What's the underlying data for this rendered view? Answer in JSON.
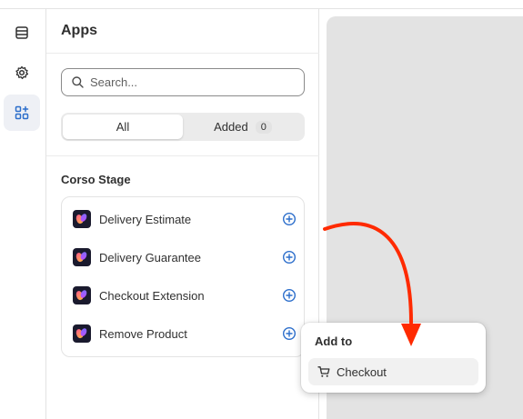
{
  "panel": {
    "title": "Apps"
  },
  "search": {
    "placeholder": "Search..."
  },
  "filter": {
    "all_label": "All",
    "added_label": "Added",
    "added_count": "0",
    "selected": "All"
  },
  "section": {
    "title": "Corso Stage"
  },
  "apps": [
    {
      "name": "Delivery Estimate"
    },
    {
      "name": "Delivery Guarantee"
    },
    {
      "name": "Checkout Extension"
    },
    {
      "name": "Remove Product"
    }
  ],
  "popover": {
    "title": "Add to",
    "item_label": "Checkout",
    "item_icon": "cart-icon"
  },
  "rail": {
    "items": [
      {
        "icon": "sections-icon"
      },
      {
        "icon": "gear-icon"
      },
      {
        "icon": "apps-icon",
        "active": true
      }
    ]
  },
  "colors": {
    "accent": "#2c6ecb",
    "annotation_arrow": "#ff2a00",
    "canvas": "#e3e3e3"
  }
}
